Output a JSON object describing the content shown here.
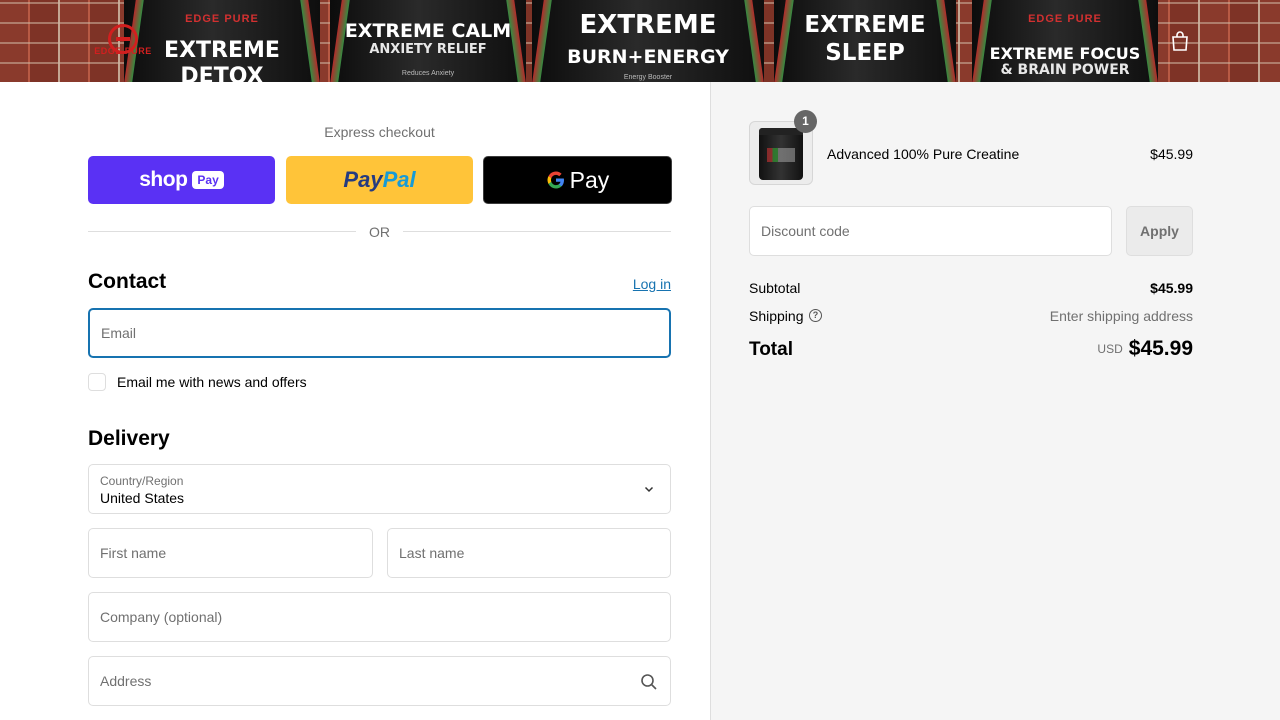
{
  "banner": {
    "logo_text": "EDGE PURE",
    "products": [
      {
        "brand": "EDGE PURE",
        "line1": "EXTREME",
        "line2": "DETOX",
        "tagline": ""
      },
      {
        "brand": "",
        "line1": "EXTREME CALM",
        "line2": "ANXIETY RELIEF",
        "tagline": "Reduces Anxiety"
      },
      {
        "brand": "",
        "line1": "EXTREME",
        "line2": "BURN+ENERGY",
        "tagline": "Energy Booster"
      },
      {
        "brand": "",
        "line1": "EXTREME",
        "line2": "SLEEP",
        "tagline": ""
      },
      {
        "brand": "EDGE PURE",
        "line1": "EXTREME FOCUS",
        "line2": "& BRAIN POWER",
        "tagline": ""
      }
    ],
    "cart_icon": "shopping-bag-icon"
  },
  "express": {
    "label": "Express checkout",
    "shop_pay": {
      "word": "shop",
      "badge": "Pay"
    },
    "paypal": {
      "part1": "Pay",
      "part2": "Pal"
    },
    "gpay": {
      "g": "G",
      "word": "Pay"
    },
    "or": "OR"
  },
  "contact": {
    "title": "Contact",
    "login": "Log in",
    "email_placeholder": "Email",
    "newsletter": "Email me with news and offers"
  },
  "delivery": {
    "title": "Delivery",
    "country_label": "Country/Region",
    "country_value": "United States",
    "first_name": "First name",
    "last_name": "Last name",
    "company": "Company (optional)",
    "address": "Address"
  },
  "summary": {
    "item": {
      "name": "Advanced 100% Pure Creatine",
      "price": "$45.99",
      "qty": "1"
    },
    "discount_placeholder": "Discount code",
    "apply": "Apply",
    "subtotal_label": "Subtotal",
    "subtotal": "$45.99",
    "shipping_label": "Shipping",
    "shipping_value": "Enter shipping address",
    "total_label": "Total",
    "currency": "USD",
    "total": "$45.99"
  },
  "colors": {
    "accent": "#1773b0",
    "shop_pay": "#5a31f4",
    "paypal": "#ffc439",
    "sidebar_bg": "#f5f5f5"
  }
}
